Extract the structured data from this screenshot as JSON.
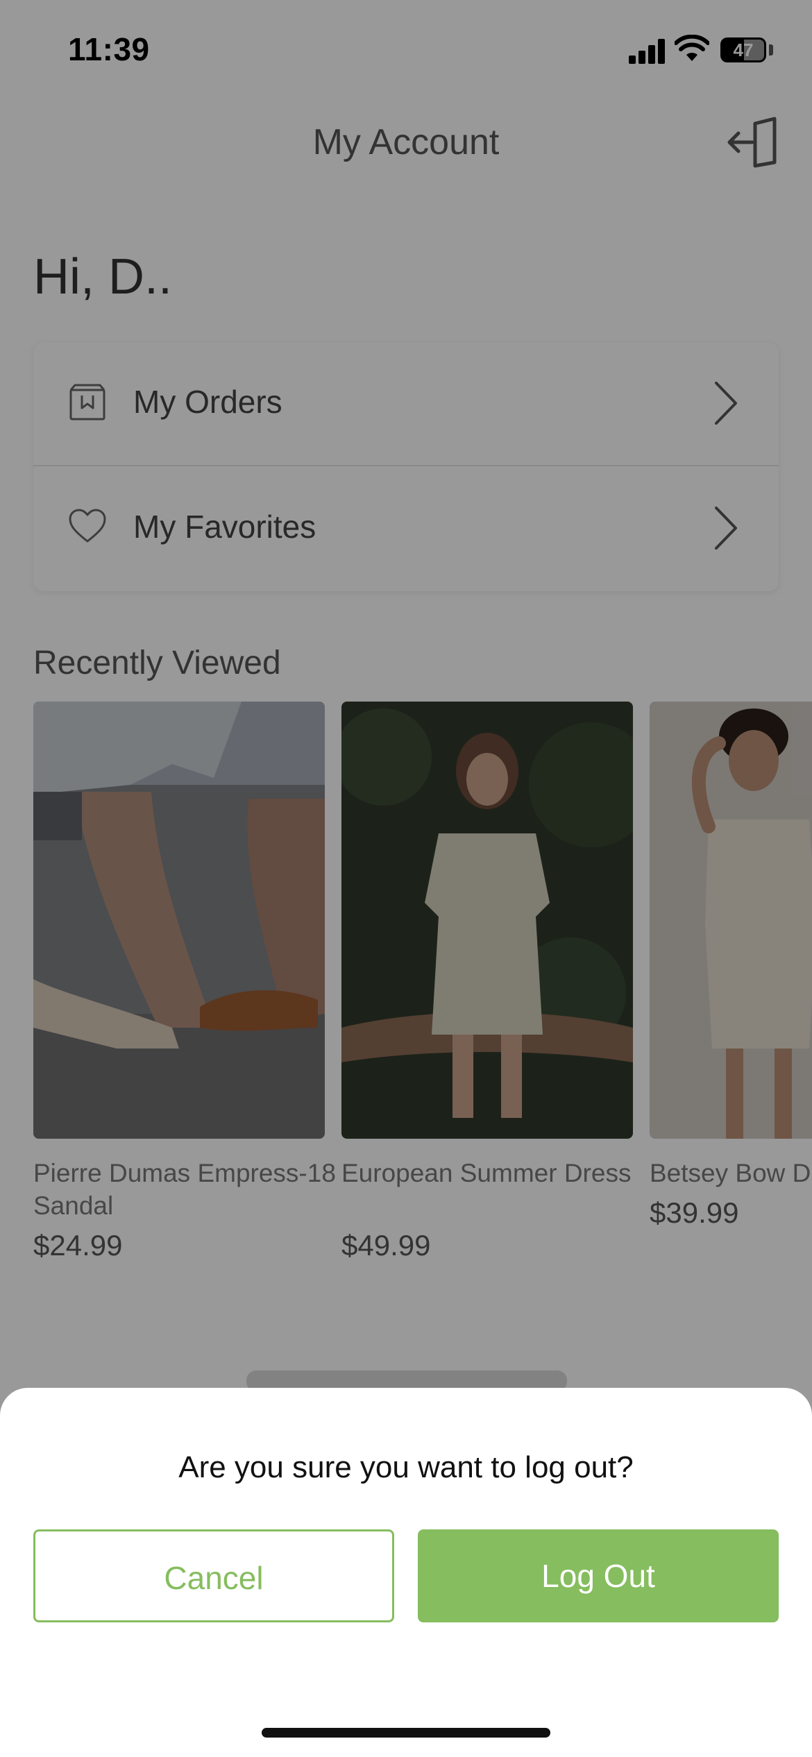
{
  "status_bar": {
    "time": "11:39",
    "battery": "47",
    "icons": [
      "cellular-signal-icon",
      "wifi-icon",
      "battery-icon"
    ]
  },
  "header": {
    "title": "My Account",
    "logout_icon": "logout-icon"
  },
  "greeting": "Hi, D..",
  "menu": {
    "items": [
      {
        "label": "My Orders",
        "icon": "orders-bag-icon"
      },
      {
        "label": "My Favorites",
        "icon": "heart-icon"
      }
    ]
  },
  "recently_viewed": {
    "title": "Recently Viewed",
    "products": [
      {
        "name": "Pierre Dumas Empress-18 Sandal",
        "price": "$24.99"
      },
      {
        "name": "European Summer Dress",
        "price": "$49.99"
      },
      {
        "name": "Betsey Bow D",
        "price": "$39.99"
      }
    ]
  },
  "dialog": {
    "question": "Are you sure you want to log out?",
    "cancel_label": "Cancel",
    "logout_label": "Log Out"
  },
  "colors": {
    "accent": "#86bd5f",
    "overlay": "rgba(0,0,0,0.40)"
  }
}
